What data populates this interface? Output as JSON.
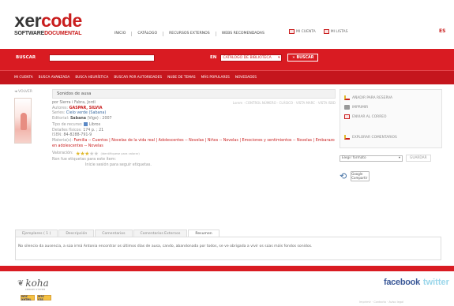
{
  "header": {
    "logo_x": "x",
    "logo_er": "er",
    "logo_code": "code",
    "logo_sub_a": "SOFTWARE",
    "logo_sub_b": "DOCUMENTAL",
    "nav": [
      "INICIO",
      "CATÁLOGO",
      "RECURSOS EXTERNOS",
      "WEBS RECOMENDADAS"
    ],
    "quick": [
      "MI CUENTA",
      "MI LISTAS"
    ],
    "lang": "ES"
  },
  "search": {
    "label": "BUSCAR",
    "value": "",
    "in_label": "EN",
    "scope": "CATÁLOGO DE BIBLIOTECA",
    "button": "BUSCAR"
  },
  "subnav": [
    "MI CUENTA",
    "BUSCA AVANZADA",
    "BUSCA HEURÍSTICA",
    "BUSCAR POR AUTORIDADES",
    "NUBE DE TEMAS",
    "MÁS POPULARES",
    "NOVEDADES"
  ],
  "record": {
    "back": "◄ VOLVER",
    "title": "Sonidos de ausa",
    "actions": "Lorem · CONTROL NÚMERO · CLÁSICO · VISTA MARC · VISTA ISBD",
    "author_line": "por Sierra i Fabra, Jordi",
    "labels": {
      "authors": "Autores:",
      "series": "Series:",
      "edition": "Editorial:",
      "type": "Tipo de recurso:",
      "details": "Detalles físicos:",
      "isbn": "ISBN:",
      "subjects": "Materia(s):",
      "rating": "Valoración:"
    },
    "authors": "GASPAR, SILVIA",
    "series": "Cielo verde (Sabana)",
    "edition_pub": "Sabana",
    "edition_rest": "(Vigo) : 2007",
    "type": "Libros",
    "details": "174 p. ; 21",
    "isbn": "84-8288-791-9",
    "subjects": "Familia -- Cuentos | Novelas de la vida real | Adolescentes -- Novelas | Niños -- Novelas | Emociones y sentimientos -- Novelas | Embarazo en adolescentes -- Novelas",
    "rating_note": "(identifiquese para valorar)",
    "tags_none": "Non fue etiquetas para este ítem:",
    "tags_login": "Inicie sesión para seguir etiquetas."
  },
  "rating": {
    "value": 3,
    "max": 5
  },
  "sidebar": {
    "actions": [
      "AÑADIR PARA RESERVA",
      "IMPRIMIR",
      "ENVIAR AL CORREO"
    ],
    "comments": "EXPLORAR COMENTARIOS",
    "format": "Elegir formato",
    "save": "GUARDAR",
    "gplus": "Google Compartir"
  },
  "tabs": {
    "items": [
      "Ejemplares ( 1 )",
      "Descripción",
      "Comentarios",
      "Comentarios Externos",
      "Resumen"
    ],
    "active": 4,
    "summary": "No silencio da ausencia, a súa irmá Antonia encontrar os últimos días de ausa, cando, abandonada por todos, se ve obrigada a vivir os súas máis fondos sonidos."
  },
  "footer": {
    "koha": "koha",
    "koha_sub": "LIBRARY SYSTEM",
    "badges": [
      "W3C XHTML",
      "W3C CSS"
    ],
    "facebook": "facebook",
    "twitter": "twitter",
    "copy": "Imprimir · Contacto · Aviso legal"
  },
  "colors": {
    "brand_red": "#d91b22",
    "dark_red": "#c5161d",
    "star": "#e0b92c"
  }
}
